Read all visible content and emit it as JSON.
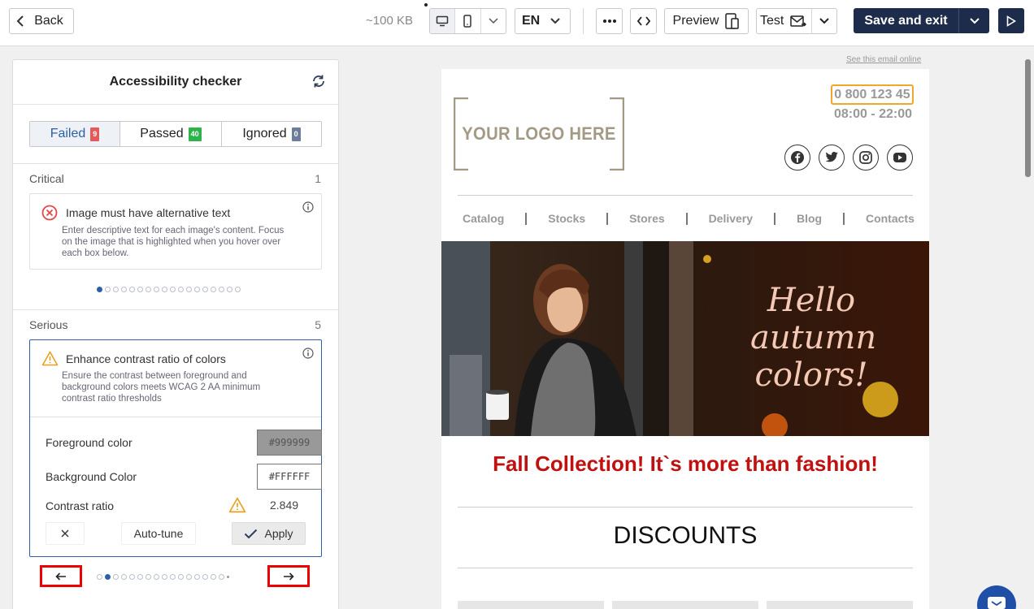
{
  "toolbar": {
    "back_label": "Back",
    "size_label": "~100 KB",
    "language": "EN",
    "preview_label": "Preview",
    "test_label": "Test",
    "save_label": "Save and exit"
  },
  "panel": {
    "title": "Accessibility checker",
    "tabs": [
      {
        "label": "Failed",
        "count": "9",
        "color": "#e35a5a"
      },
      {
        "label": "Passed",
        "count": "40",
        "color": "#2cb34a"
      },
      {
        "label": "Ignored",
        "count": "0",
        "color": "#6d7d9c"
      }
    ],
    "critical": {
      "label": "Critical",
      "count": "1",
      "issue_title": "Image must have alternative text",
      "issue_desc": "Enter descriptive text for each image's content. Focus on the image that is highlighted when you hover over each box below."
    },
    "serious": {
      "label": "Serious",
      "count": "5",
      "issue_title": "Enhance contrast ratio of colors",
      "issue_desc": "Ensure the contrast between foreground and background colors meets WCAG 2 AA minimum contrast ratio thresholds",
      "foreground_label": "Foreground color",
      "foreground_value": "#999999",
      "background_label": "Background Color",
      "background_value": "#FFFFFF",
      "ratio_label": "Contrast ratio",
      "ratio_value": "2.849",
      "autotune_label": "Auto-tune",
      "apply_label": "Apply"
    }
  },
  "email": {
    "see_online": "See this email online",
    "logo_text": "YOUR LOGO HERE",
    "phone": "0 800 123 45",
    "hours": "08:00 - 22:00",
    "menu": [
      "Catalog",
      "Stocks",
      "Stores",
      "Delivery",
      "Blog",
      "Contacts"
    ],
    "hero_text": [
      "Hello",
      "autumn",
      "colors!"
    ],
    "headline": "Fall Collection! It`s more than fashion!",
    "discounts": "DISCOUNTS"
  },
  "colors": {
    "brand_dark": "#1d2c4a",
    "accent_blue": "#2c5fa8",
    "headline_red": "#c01010",
    "phone_border": "#f2a630",
    "highlight_red": "#e00000"
  }
}
